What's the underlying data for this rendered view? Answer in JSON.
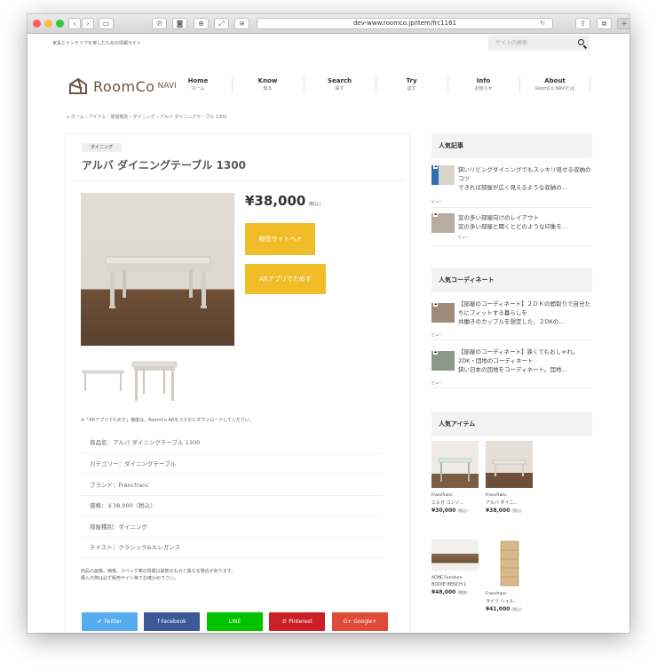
{
  "browser": {
    "url": "dev-www.roomco.jp/item/frc1161"
  },
  "site": {
    "tagline": "家具とインテリアを楽しむための情報サイト",
    "search_placeholder": "サイト内検索",
    "logo_text": "RoomCo",
    "logo_sub": "NAVI"
  },
  "nav": [
    {
      "en": "Home",
      "ja": "ホーム"
    },
    {
      "en": "Know",
      "ja": "知る"
    },
    {
      "en": "Search",
      "ja": "探す"
    },
    {
      "en": "Try",
      "ja": "試す"
    },
    {
      "en": "Info",
      "ja": "お知らせ"
    },
    {
      "en": "About",
      "ja": "RoomCo NAVIとは"
    }
  ],
  "breadcrumb": "ホーム › アイテム › 部屋種別 › ダイニング › アルバ ダイニングテーブル 1300",
  "item": {
    "category": "ダイニング",
    "title": "アルバ ダイニングテーブル 1300",
    "price": "¥38,000",
    "tax": "(税込)",
    "buy_button": "販売サイトへ↗",
    "ar_button": "ARアプリでためす",
    "ar_note": "※「ARアプリでためす」機能は、RoomCo ARをスマホにダウンロードしてください。",
    "specs": [
      "商品名：アルバ ダイニングテーブル 1300",
      "カテゴリー：ダイニングテーブル",
      "ブランド：Francfranc",
      "価格：￥38,000（税込）",
      "部屋種別：ダイニング",
      "テイスト：クラシック&エレガンス"
    ],
    "disclaimer": [
      "商品の画像、価格、スペック等の情報は最新のものと異なる場合があります。",
      "購入の際は必ず販売サイト等でお確かめ下さい。"
    ]
  },
  "share": {
    "twitter": "Twitter",
    "facebook": "Facebook",
    "line": "LINE",
    "pinterest": "Pinterest",
    "google": "Google+"
  },
  "sidebar": {
    "popular_articles_title": "人気記事",
    "articles": [
      {
        "rank": "1",
        "title": "狭いリビングダイニングでもスッキリ見せる収納のコツ",
        "excerpt": "できれば部屋が広く見えるような収納の…",
        "views": "ビュー"
      },
      {
        "rank": "2",
        "title": "窓の多い部屋向けのレイアウト",
        "excerpt": "窓の多い部屋と聞くとどのような印象を…",
        "views": "ビュー"
      }
    ],
    "popular_coordinates_title": "人気コーディネート",
    "coordinates": [
      {
        "rank": "1",
        "title": "【部屋のコーディネート】２ＤＫの間取りで自分たちにフィットする暮らしを",
        "excerpt": "共働きのカップルを想定した、２DKの…",
        "views": "ビュー"
      },
      {
        "rank": "2",
        "title": "【部屋のコーディネート】狭くてもおしゃれ。2DK・団地のコーディネート",
        "excerpt": "狭い日本の団地をコーディネート。団地…",
        "views": "ビュー"
      }
    ],
    "popular_items_title": "人気アイテム",
    "items": [
      {
        "brand": "Francfranc",
        "name": "エルガ コンソ…",
        "price": "¥30,000",
        "tax": "(税込)"
      },
      {
        "brand": "Francfranc",
        "name": "アルバ ダイニ…",
        "price": "¥38,000",
        "tax": "(税込)"
      },
      {
        "brand": "ACME Furniture",
        "name": "BODIE BENCH L",
        "price": "¥48,000",
        "tax": "(税抜)"
      },
      {
        "brand": "Francfranc",
        "name": "ライツ シェル…",
        "price": "¥41,000",
        "tax": "(税込)"
      }
    ]
  }
}
